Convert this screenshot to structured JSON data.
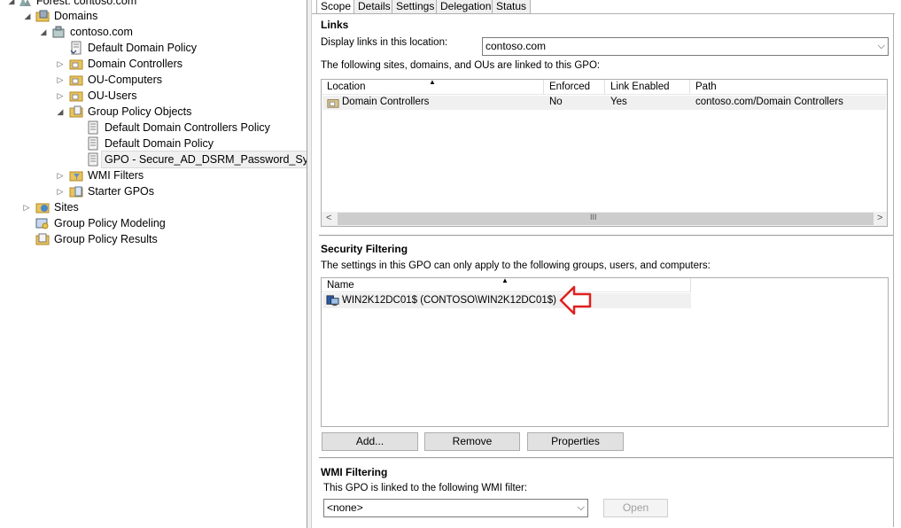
{
  "tree": {
    "forest": "Forest: contoso.com",
    "domains": "Domains",
    "domain": "contoso.com",
    "default_domain_policy": "Default Domain Policy",
    "domain_controllers": "Domain Controllers",
    "ou_computers": "OU-Computers",
    "ou_users": "OU-Users",
    "gpo_folder": "Group Policy Objects",
    "gpo_ddcp": "Default Domain Controllers Policy",
    "gpo_ddp": "Default Domain Policy",
    "gpo_selected": "GPO - Secure_AD_DSRM_Password_Sync",
    "wmi_filters": "WMI Filters",
    "starter_gpos": "Starter GPOs",
    "sites": "Sites",
    "gp_modeling": "Group Policy Modeling",
    "gp_results": "Group Policy Results"
  },
  "tabs": [
    "Scope",
    "Details",
    "Settings",
    "Delegation",
    "Status"
  ],
  "links": {
    "title": "Links",
    "display_label": "Display links in this location:",
    "location_value": "contoso.com",
    "desc": "The following sites, domains, and OUs are linked to this GPO:",
    "columns": [
      "Location",
      "Enforced",
      "Link Enabled",
      "Path"
    ],
    "rows": [
      [
        "Domain Controllers",
        "No",
        "Yes",
        "contoso.com/Domain Controllers"
      ]
    ]
  },
  "security": {
    "title": "Security Filtering",
    "desc": "The settings in this GPO can only apply to the following groups, users, and computers:",
    "column": "Name",
    "entry": "WIN2K12DC01$ (CONTOSO\\WIN2K12DC01$)",
    "add": "Add...",
    "remove": "Remove",
    "properties": "Properties"
  },
  "wmi": {
    "title": "WMI Filtering",
    "desc": "This GPO is linked to the following WMI filter:",
    "value": "<none>",
    "open": "Open"
  },
  "colors": {
    "arrow": "#e02020",
    "selection": "#f0f0f0"
  }
}
